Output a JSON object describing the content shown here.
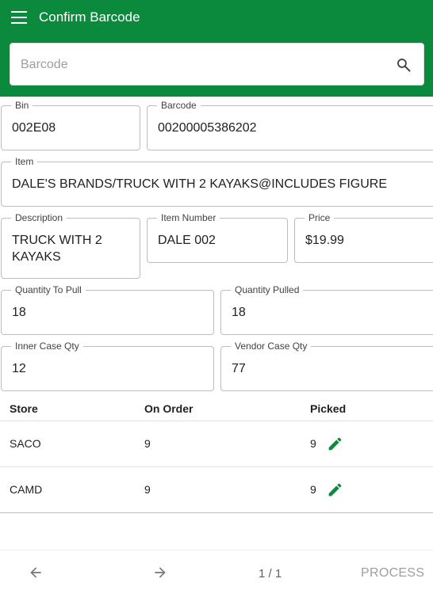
{
  "header": {
    "title": "Confirm Barcode"
  },
  "search": {
    "placeholder": "Barcode",
    "value": ""
  },
  "fields": {
    "bin": {
      "label": "Bin",
      "value": "002E08"
    },
    "barcode": {
      "label": "Barcode",
      "value": "00200005386202"
    },
    "item": {
      "label": "Item",
      "value": "DALE'S BRANDS/TRUCK WITH 2 KAYAKS@INCLUDES FIGURE"
    },
    "description": {
      "label": "Description",
      "value": "TRUCK WITH 2 KAYAKS"
    },
    "item_number": {
      "label": "Item Number",
      "value": "DALE 002"
    },
    "price": {
      "label": "Price",
      "value": "$19.99"
    },
    "qty_to_pull": {
      "label": "Quantity To Pull",
      "value": "18"
    },
    "qty_pulled": {
      "label": "Quantity Pulled",
      "value": "18"
    },
    "inner_case_qty": {
      "label": "Inner Case Qty",
      "value": "12"
    },
    "vendor_case_qty": {
      "label": "Vendor Case Qty",
      "value": "77"
    }
  },
  "table": {
    "columns": [
      "Store",
      "On Order",
      "Picked"
    ],
    "rows": [
      {
        "store": "SACO",
        "on_order": "9",
        "picked": "9"
      },
      {
        "store": "CAMD",
        "on_order": "9",
        "picked": "9"
      }
    ]
  },
  "footer": {
    "page": "1 / 1",
    "process_label": "PROCESS"
  },
  "colors": {
    "primary": "#0b8a3e",
    "border": "#bdbdbd",
    "disabled_text": "#9e9e9e"
  },
  "icons": [
    "menu-icon",
    "search-icon",
    "edit-icon",
    "arrow-back-icon",
    "arrow-forward-icon"
  ]
}
